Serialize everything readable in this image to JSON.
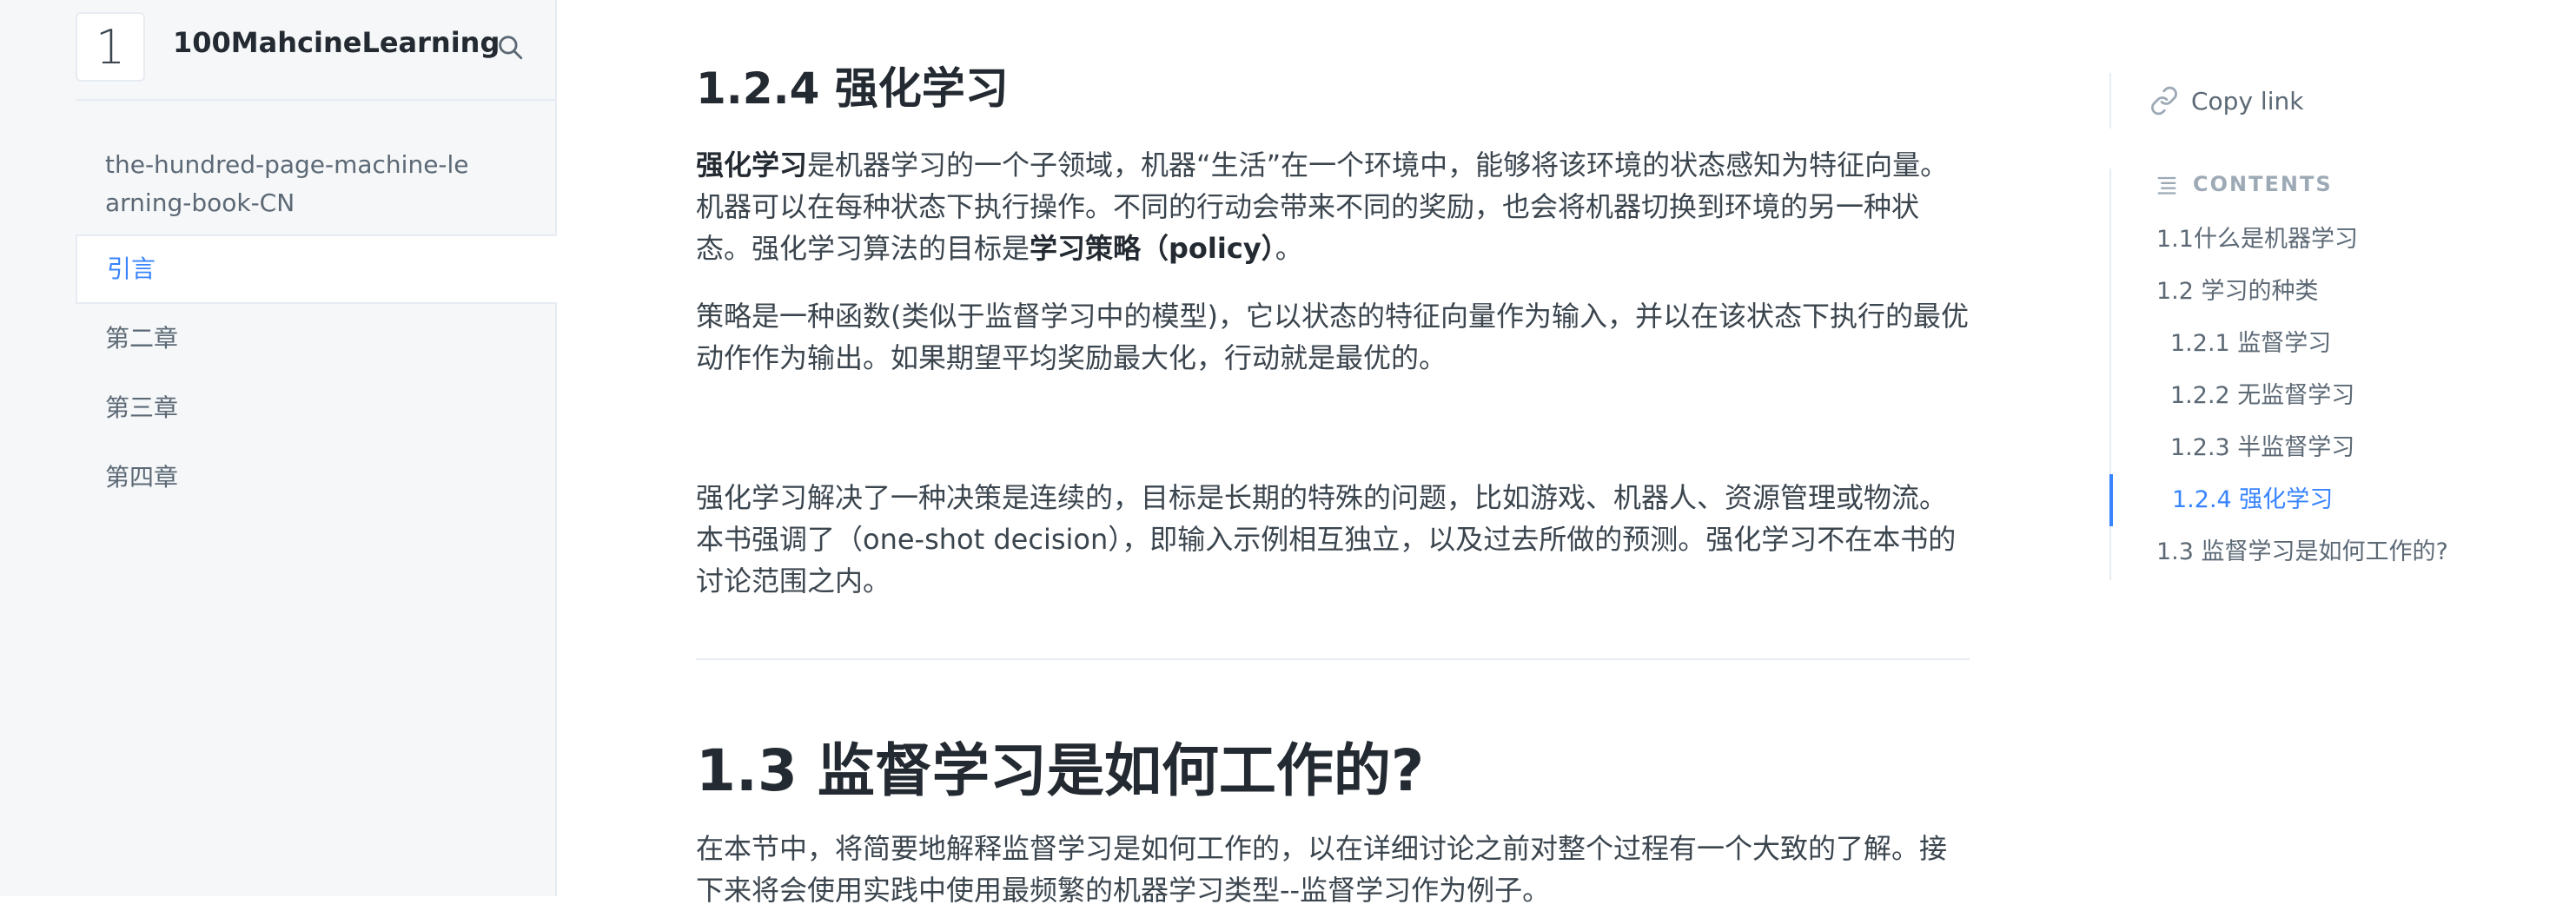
{
  "sidebar": {
    "logo_text": "1",
    "site_title": "100MahcineLearning",
    "search_icon": "search-icon",
    "nav_items": [
      {
        "label": "the-hundred-page-machine-learning-book-CN"
      },
      {
        "label": "引言"
      },
      {
        "label": "第二章"
      },
      {
        "label": "第三章"
      },
      {
        "label": "第四章"
      }
    ]
  },
  "main": {
    "section_124": {
      "heading": "1.2.4 强化学习",
      "p1_bold1": "强化学习",
      "p1_text1": "是机器学习的一个子领域，机器“生活”在一个环境中，能够将该环境的状态感知为特征向量。机器可以在每种状态下执行操作。不同的行动会带来不同的奖励，也会将机器切换到环境的另一种状态。强化学习算法的目标是",
      "p1_bold2": "学习策略（policy）",
      "p1_text2": "。",
      "p2": "策略是一种函数(类似于监督学习中的模型)，它以状态的特征向量作为输入，并以在该状态下执行的最优动作作为输出。如果期望平均奖励最大化，行动就是最优的。",
      "p3": "强化学习解决了一种决策是连续的，目标是长期的特殊的问题，比如游戏、机器人、资源管理或物流。本书强调了（one-shot decision），即输入示例相互独立，以及过去所做的预测。强化学习不在本书的讨论范围之内。"
    },
    "section_13": {
      "heading": "1.3 监督学习是如何工作的?",
      "p1": "在本节中，将简要地解释监督学习是如何工作的，以在详细讨论之前对整个过程有一个大致的了解。接下来将会使用实践中使用最频繁的机器学习类型--监督学习作为例子。"
    }
  },
  "toc": {
    "copy_link": "Copy link",
    "contents_label": "CONTENTS",
    "items": [
      {
        "label": "1.1什么是机器学习"
      },
      {
        "label": "1.2 学习的种类"
      },
      {
        "label": "1.2.1 监督学习"
      },
      {
        "label": "1.2.2 无监督学习"
      },
      {
        "label": "1.2.3 半监督学习"
      },
      {
        "label": "1.2.4 强化学习"
      },
      {
        "label": "1.3 监督学习是如何工作的?"
      }
    ],
    "active_item": "1.2.4 强化学习"
  },
  "colors": {
    "accent": "#3884ff",
    "text": "#3b454e",
    "heading": "#242a31",
    "sidebar_bg": "#f5f7f9",
    "border": "#e6ecf1",
    "muted": "#9daab6"
  }
}
